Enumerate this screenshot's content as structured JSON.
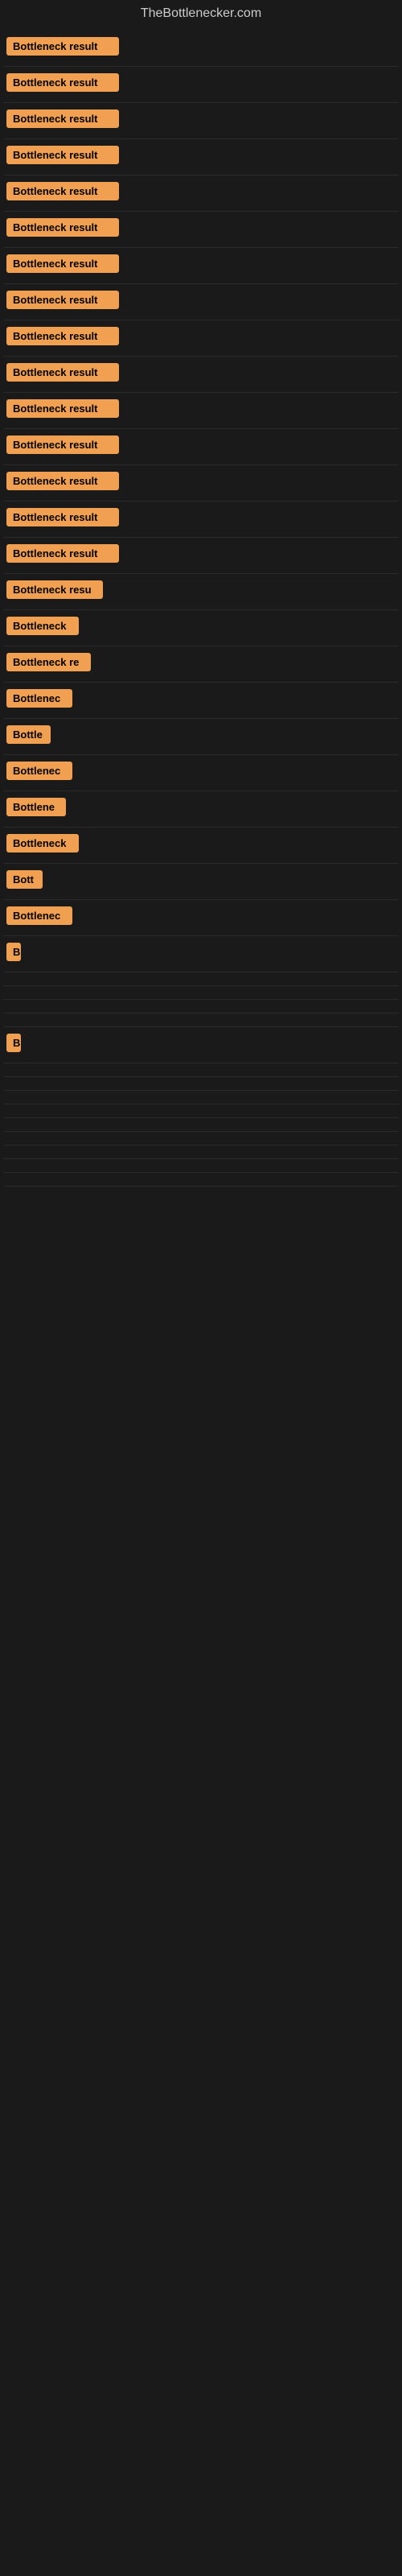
{
  "header": {
    "title": "TheBottlenecker.com"
  },
  "items": [
    {
      "label": "Bottleneck result",
      "width": 140
    },
    {
      "label": "Bottleneck result",
      "width": 140
    },
    {
      "label": "Bottleneck result",
      "width": 140
    },
    {
      "label": "Bottleneck result",
      "width": 140
    },
    {
      "label": "Bottleneck result",
      "width": 140
    },
    {
      "label": "Bottleneck result",
      "width": 140
    },
    {
      "label": "Bottleneck result",
      "width": 140
    },
    {
      "label": "Bottleneck result",
      "width": 140
    },
    {
      "label": "Bottleneck result",
      "width": 140
    },
    {
      "label": "Bottleneck result",
      "width": 140
    },
    {
      "label": "Bottleneck result",
      "width": 140
    },
    {
      "label": "Bottleneck result",
      "width": 140
    },
    {
      "label": "Bottleneck result",
      "width": 140
    },
    {
      "label": "Bottleneck result",
      "width": 140
    },
    {
      "label": "Bottleneck result",
      "width": 140
    },
    {
      "label": "Bottleneck resu",
      "width": 120
    },
    {
      "label": "Bottleneck",
      "width": 90
    },
    {
      "label": "Bottleneck re",
      "width": 105
    },
    {
      "label": "Bottlenec",
      "width": 82
    },
    {
      "label": "Bottle",
      "width": 55
    },
    {
      "label": "Bottlenec",
      "width": 82
    },
    {
      "label": "Bottlene",
      "width": 74
    },
    {
      "label": "Bottleneck",
      "width": 90
    },
    {
      "label": "Bott",
      "width": 45
    },
    {
      "label": "Bottlenec",
      "width": 82
    },
    {
      "label": "B",
      "width": 18
    },
    {
      "label": "",
      "width": 0
    },
    {
      "label": "",
      "width": 0
    },
    {
      "label": "",
      "width": 0
    },
    {
      "label": "",
      "width": 0
    },
    {
      "label": "B",
      "width": 18
    },
    {
      "label": "",
      "width": 0
    },
    {
      "label": "",
      "width": 0
    },
    {
      "label": "",
      "width": 0
    },
    {
      "label": "",
      "width": 0
    },
    {
      "label": "",
      "width": 0
    },
    {
      "label": "",
      "width": 0
    },
    {
      "label": "",
      "width": 0
    },
    {
      "label": "",
      "width": 0
    },
    {
      "label": "",
      "width": 0
    }
  ],
  "badge_color": "#f0a050"
}
